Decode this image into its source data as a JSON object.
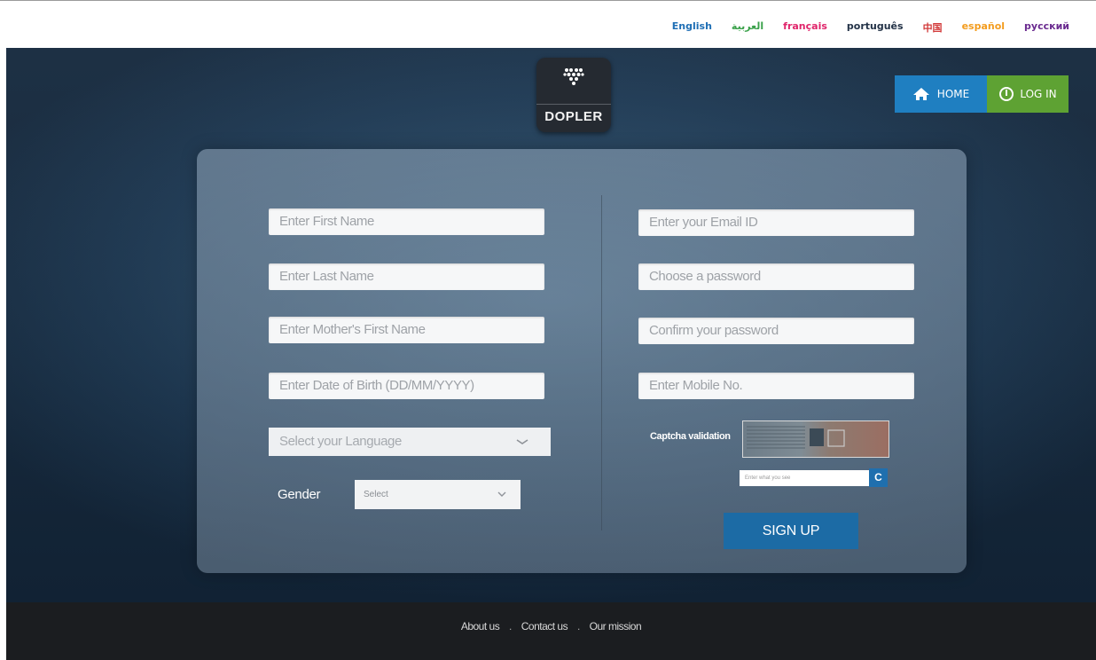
{
  "languages": [
    {
      "label": "English",
      "color": "#1f6fb5"
    },
    {
      "label": "العربية",
      "color": "#3aa14a"
    },
    {
      "label": "français",
      "color": "#e0246a"
    },
    {
      "label": "português",
      "color": "#233247"
    },
    {
      "label": "中国",
      "color": "#d23a3a"
    },
    {
      "label": "español",
      "color": "#f39c1e"
    },
    {
      "label": "русский",
      "color": "#6a2a8f"
    }
  ],
  "brand": {
    "name": "DOPLER"
  },
  "nav": {
    "home_label": "HOME",
    "login_label": "LOG IN"
  },
  "form": {
    "first_name_placeholder": "Enter First Name",
    "last_name_placeholder": "Enter Last Name",
    "mother_name_placeholder": "Enter Mother's First Name",
    "dob_placeholder": "Enter Date of Birth (DD/MM/YYYY)",
    "language_select": "Select your Language",
    "gender_label": "Gender",
    "gender_select": "Select",
    "email_placeholder": "Enter your Email ID",
    "password_placeholder": "Choose a password",
    "confirm_password_placeholder": "Confirm your password",
    "mobile_placeholder": "Enter Mobile No.",
    "captcha_label": "Captcha validation",
    "captcha_input_placeholder": "Enter what you see",
    "refresh_label": "C",
    "signup_label": "SIGN UP"
  },
  "footer": {
    "links": [
      "About us",
      "Contact us",
      "Our mission"
    ],
    "separator": "."
  }
}
